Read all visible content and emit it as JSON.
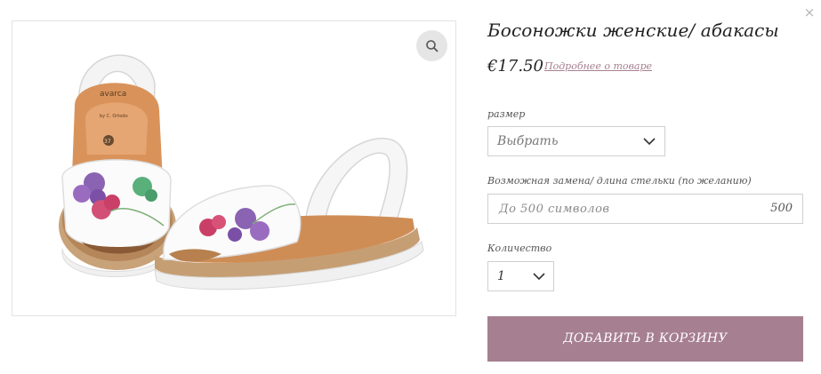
{
  "product": {
    "title": "Босоножки женские/ абакасы",
    "price": "€17.50",
    "details_link": "Подробнее о товаре",
    "brand_on_insole": "avarca",
    "insole_maker": "by C. Ortodo",
    "insole_size": "37"
  },
  "options": {
    "size_label": "размер",
    "size_value": "Выбрать",
    "insole_label": "Возможная замена/ длина стельки (по желанию)",
    "insole_placeholder": "До 500 символов",
    "insole_counter": "500",
    "qty_label": "Количество",
    "qty_value": "1"
  },
  "actions": {
    "add_to_cart": "ДОБАВИТЬ В КОРЗИНУ",
    "close": "×"
  },
  "icons": {
    "close": "close-icon",
    "zoom": "zoom-icon",
    "dropdown": "chevron-down-icon"
  },
  "colors": {
    "accent": "#a67f90",
    "link": "#a78090",
    "border": "#cfcfcf"
  }
}
